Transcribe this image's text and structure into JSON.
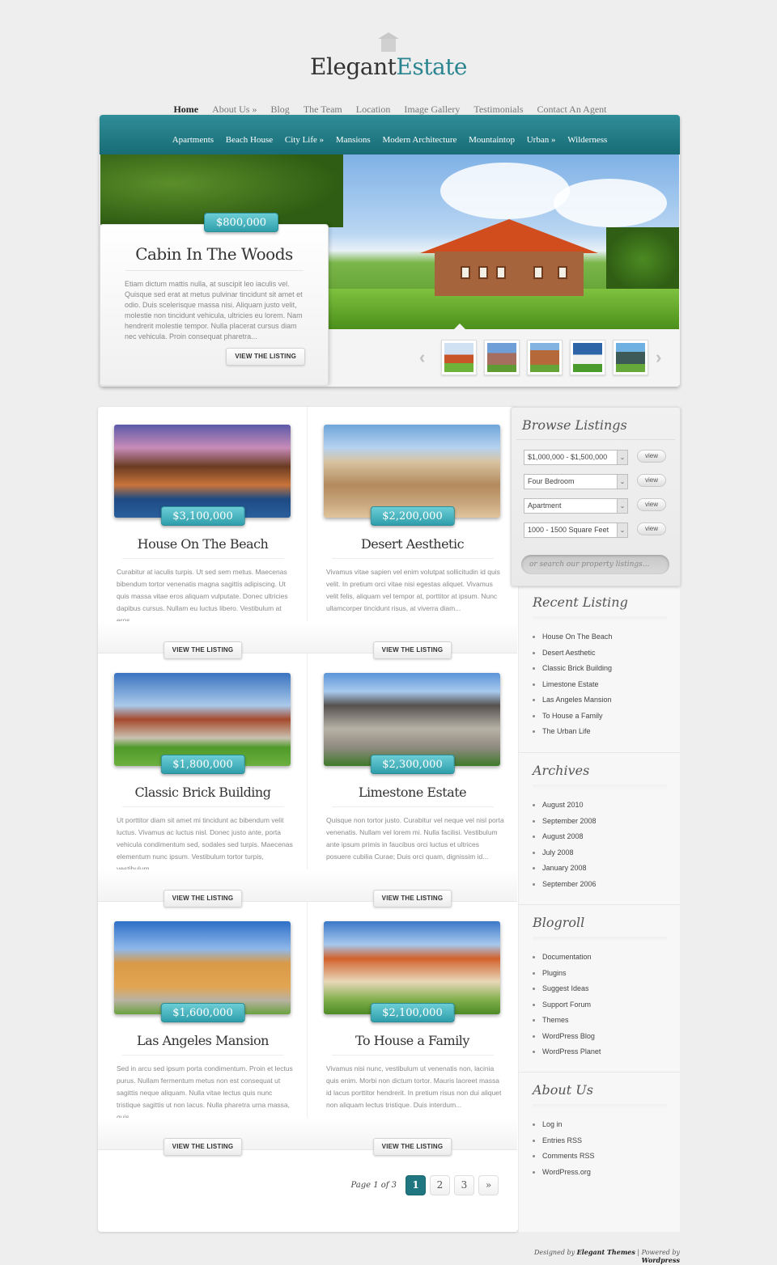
{
  "logo": {
    "part1": "Elegant",
    "part2": "Estate"
  },
  "top_nav": [
    "Home",
    "About Us »",
    "Blog",
    "The Team",
    "Location",
    "Image Gallery",
    "Testimonials",
    "Contact An Agent"
  ],
  "category_nav": [
    "Apartments",
    "Beach House",
    "City Life »",
    "Mansions",
    "Modern Architecture",
    "Mountaintop",
    "Urban »",
    "Wilderness"
  ],
  "featured": {
    "price": "$800,000",
    "title": "Cabin In The Woods",
    "excerpt": "Etiam dictum mattis nulla, at suscipit leo iaculis vel. Quisque sed erat at metus pulvinar tincidunt sit amet et odio. Duis scelerisque massa nisi. Aliquam justo velit, molestie non tincidunt vehicula, ultricies eu lorem. Nam hendrerit molestie tempor. Nulla placerat cursus diam nec vehicula. Proin consequat pharetra...",
    "button": "View the Listing",
    "prev_icon": "‹",
    "next_icon": "›",
    "thumbnail_count": 5
  },
  "listings": [
    {
      "price": "$3,100,000",
      "title": "House On The Beach",
      "excerpt": "Curabitur at iaculis turpis. Ut sed sem metus. Maecenas bibendum tortor venenatis magna sagittis adipiscing. Ut quis massa vitae eros aliquam vulputate. Donec ultricies dapibus cursus. Nullam eu luctus libero. Vestibulum at eros...",
      "button": "View the Listing"
    },
    {
      "price": "$2,200,000",
      "title": "Desert Aesthetic",
      "excerpt": "Vivamus vitae sapien vel enim volutpat sollicitudin id quis velit. In pretium orci vitae nisi egestas aliquet. Vivamus velit felis, aliquam vel tempor at, porttitor at ipsum. Nunc ullamcorper tincidunt risus, at viverra diam...",
      "button": "View the Listing"
    },
    {
      "price": "$1,800,000",
      "title": "Classic Brick Building",
      "excerpt": "Ut porttitor diam sit amet mi tincidunt ac bibendum velit luctus. Vivamus ac luctus nisl. Donec justo ante, porta vehicula condimentum sed, sodales sed turpis. Maecenas elementum nunc ipsum. Vestibulum tortor turpis, vestibulum...",
      "button": "View the Listing"
    },
    {
      "price": "$2,300,000",
      "title": "Limestone Estate",
      "excerpt": "Quisque non tortor justo. Curabitur vel neque vel nisl porta venenatis. Nullam vel lorem mi. Nulla facilisi. Vestibulum ante ipsum primis in faucibus orci luctus et ultrices posuere cubilia Curae; Duis orci quam, dignissim id...",
      "button": "View the Listing"
    },
    {
      "price": "$1,600,000",
      "title": "Las Angeles Mansion",
      "excerpt": "Sed in arcu sed ipsum porta condimentum. Proin et lectus purus. Nullam fermentum metus non est consequat ut sagittis neque aliquam. Nulla vitae lectus quis nunc tristique sagittis ut non lacus. Nulla pharetra urna massa, quis...",
      "button": "View the Listing"
    },
    {
      "price": "$2,100,000",
      "title": "To House a Family",
      "excerpt": "Vivamus nisi nunc, vestibulum ut venenatis non, lacinia quis enim. Morbi non dictum tortor. Mauris laoreet massa id lacus porttitor hendrerit. In pretium risus non dui aliquet non aliquam lectus tristique. Duis interdum...",
      "button": "View the Listing"
    }
  ],
  "pagination": {
    "label": "Page 1 of 3",
    "pages": [
      "1",
      "2",
      "3",
      "»"
    ],
    "current": "1"
  },
  "browse": {
    "title": "Browse Listings",
    "filters": [
      {
        "value": "$1,000,000 - $1,500,000",
        "button": "view"
      },
      {
        "value": "Four Bedroom",
        "button": "view"
      },
      {
        "value": "Apartment",
        "button": "view"
      },
      {
        "value": "1000 - 1500 Square Feet",
        "button": "view"
      }
    ],
    "search_placeholder": "or search our property listings..."
  },
  "widgets": {
    "recent": {
      "title": "Recent Listing",
      "items": [
        "House On The Beach",
        "Desert Aesthetic",
        "Classic Brick Building",
        "Limestone Estate",
        "Las Angeles Mansion",
        "To House a Family",
        "The Urban Life"
      ]
    },
    "archives": {
      "title": "Archives",
      "items": [
        "August 2010",
        "September 2008",
        "August 2008",
        "July 2008",
        "January 2008",
        "September 2006"
      ]
    },
    "blogroll": {
      "title": "Blogroll",
      "items": [
        "Documentation",
        "Plugins",
        "Suggest Ideas",
        "Support Forum",
        "Themes",
        "WordPress Blog",
        "WordPress Planet"
      ]
    },
    "about": {
      "title": "About Us",
      "items": [
        "Log in",
        "Entries RSS",
        "Comments RSS",
        "WordPress.org"
      ]
    }
  },
  "footer": {
    "designed_by": "Designed by",
    "designer": "Elegant Themes",
    "sep": " | ",
    "powered_by": "Powered by",
    "platform": "Wordpress"
  },
  "colors": {
    "accent": "#1f7680",
    "price_tag": "#3aa9b5"
  }
}
